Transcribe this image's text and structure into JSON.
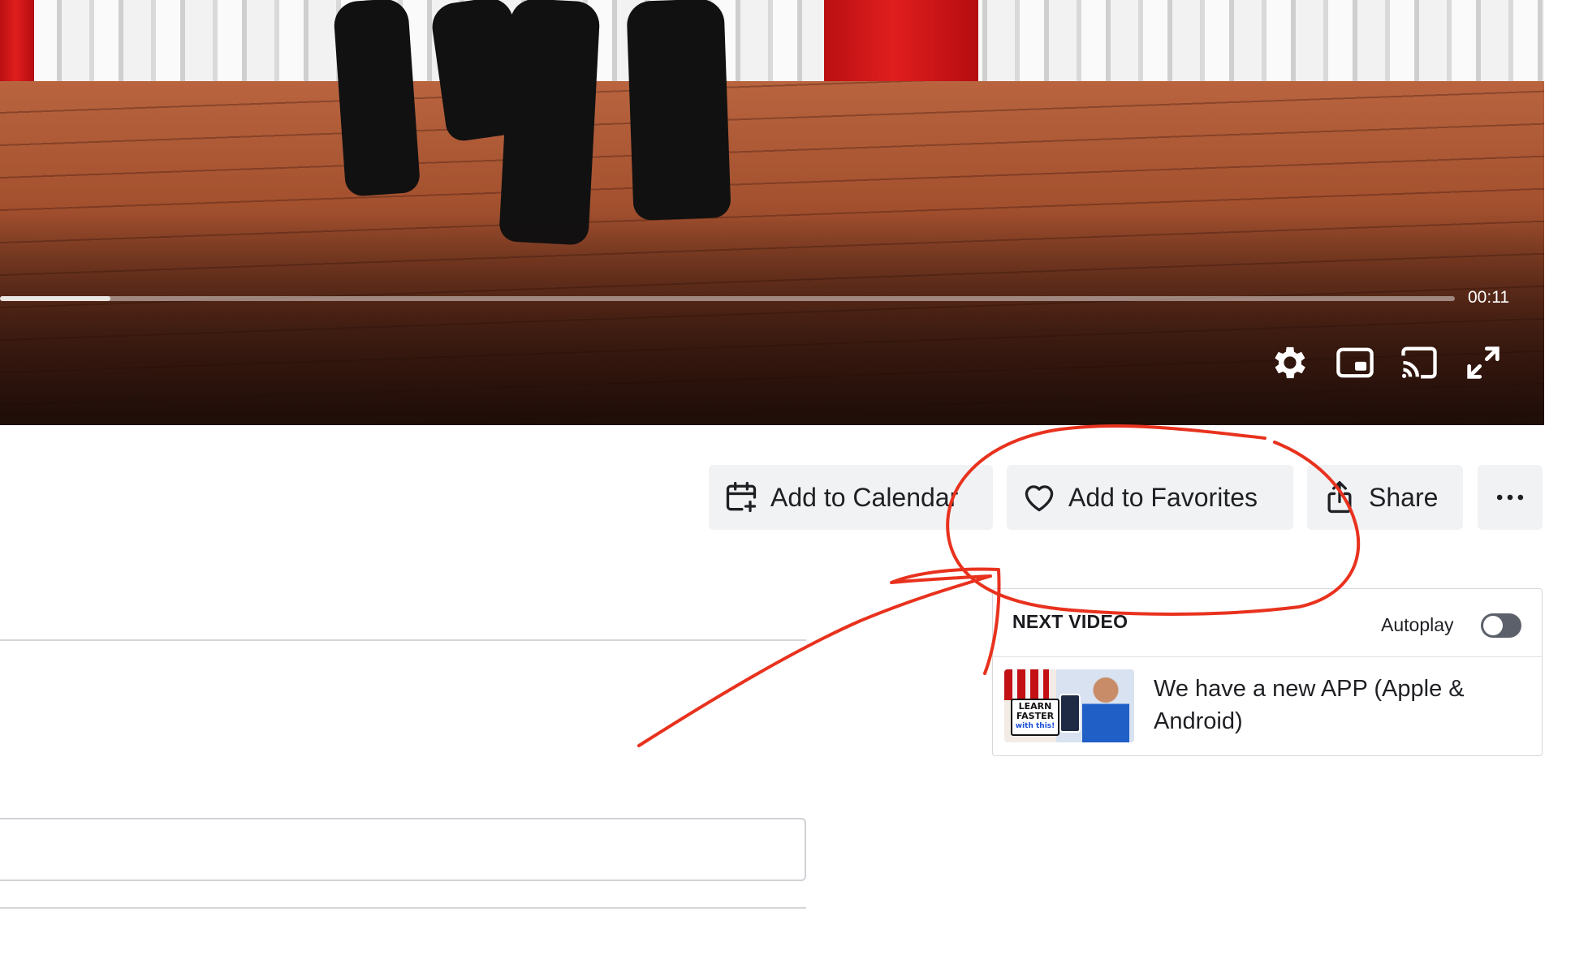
{
  "player": {
    "elapsed_fraction": 0.076,
    "time_display": "00:11",
    "controls": [
      {
        "name": "settings",
        "icon": "gear-icon"
      },
      {
        "name": "miniplayer",
        "icon": "picture-in-picture-icon"
      },
      {
        "name": "cast",
        "icon": "cast-icon"
      },
      {
        "name": "fullscreen",
        "icon": "fullscreen-icon"
      }
    ]
  },
  "actions": {
    "calendar_label": "Add to Calendar",
    "calendar_icon": "calendar-plus-icon",
    "favorites_label": "Add to Favorites",
    "favorites_icon": "heart-icon",
    "share_label": "Share",
    "share_icon": "share-icon",
    "more_icon": "more-horizontal-icon"
  },
  "next_video": {
    "heading": "NEXT VIDEO",
    "autoplay_label": "Autoplay",
    "autoplay_on": false,
    "item": {
      "title": "We have a new APP (Apple & Android)",
      "thumbnail_text": [
        "LEARN",
        "FASTER",
        "with this!"
      ]
    }
  },
  "annotation": {
    "color": "#e8321e",
    "shapes": [
      "circle around Add to Favorites",
      "arrow pointing to Add to Favorites"
    ]
  },
  "colors": {
    "button_bg": "#f1f2f4",
    "text": "#1f2024",
    "toggle_off": "#5b606a"
  }
}
